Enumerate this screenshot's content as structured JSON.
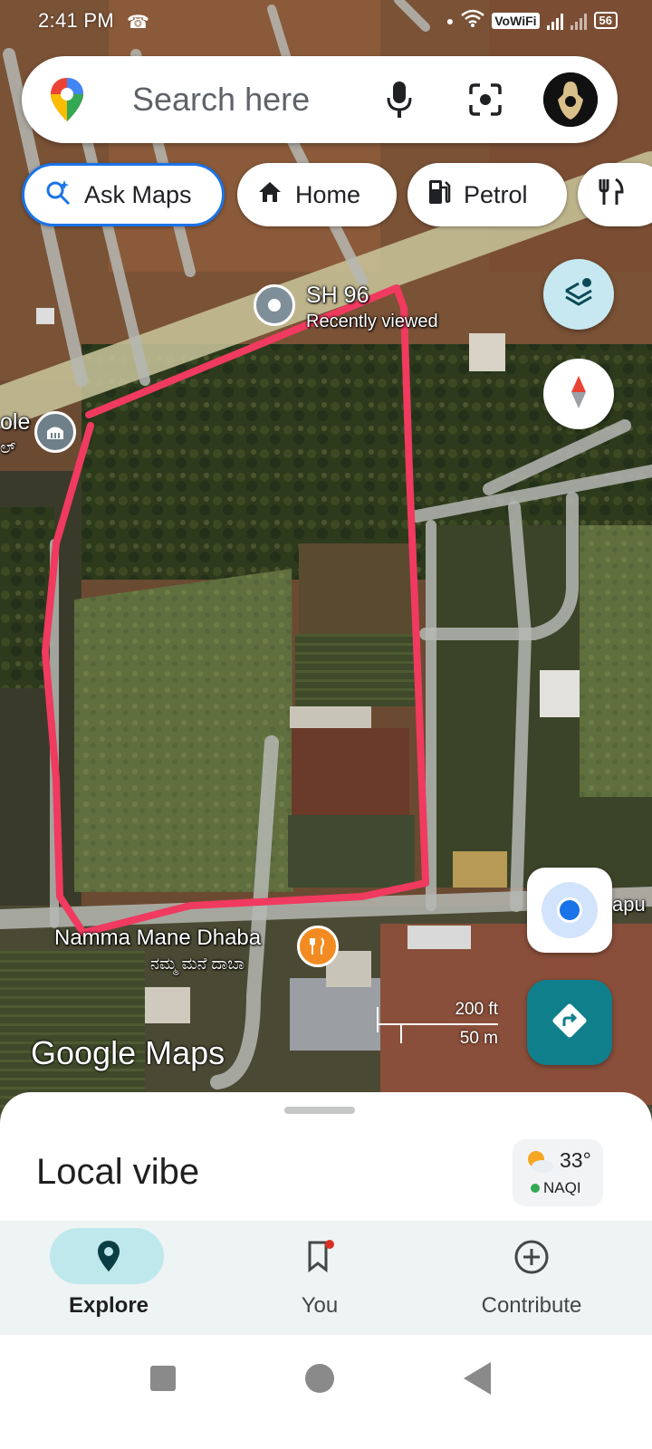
{
  "status_bar": {
    "time": "2:41 PM",
    "vowifi": "VoWiFi",
    "battery": "56"
  },
  "search": {
    "placeholder": "Search here"
  },
  "chips": [
    {
      "label": "Ask Maps",
      "icon": "sparkle-search-icon"
    },
    {
      "label": "Home",
      "icon": "home-icon"
    },
    {
      "label": "Petrol",
      "icon": "fuel-icon"
    },
    {
      "label": "",
      "icon": "restaurant-icon"
    }
  ],
  "map": {
    "road_label": "SH 96",
    "recent_label": "Recently viewed",
    "left_label_en": "ole",
    "left_label_kn": "ಲ್",
    "dhaba_en": "Namma Mane Dhaba",
    "dhaba_kn": "ನಮ್ಮ ಮನೆ ದಾಬಾ",
    "edge_label": "apu",
    "scale_ft": "200 ft",
    "scale_m": "50 m",
    "logo": "Google Maps",
    "colors": {
      "boundary": "#f03a5f",
      "road": "#b5b7b3"
    }
  },
  "sheet": {
    "title": "Local vibe",
    "weather": {
      "temp": "33°",
      "aqi": "NAQI"
    }
  },
  "nav": [
    {
      "label": "Explore",
      "icon": "explore-pin-icon",
      "active": true
    },
    {
      "label": "You",
      "icon": "bookmark-icon",
      "active": false
    },
    {
      "label": "Contribute",
      "icon": "add-circle-icon",
      "active": false
    }
  ]
}
